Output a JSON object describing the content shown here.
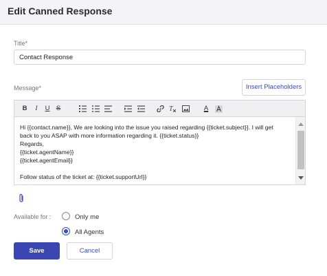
{
  "header": {
    "title": "Edit Canned Response"
  },
  "form": {
    "title_label": "Title*",
    "title_value": "Contact Response",
    "message_label": "Message*",
    "insert_placeholders_label": "Insert Placeholders",
    "toolbar": {
      "bold": "B",
      "italic": "I",
      "underline": "U",
      "strikethrough": "S",
      "font_color": "A",
      "icons": [
        "bold-icon",
        "italic-icon",
        "underline-icon",
        "strikethrough-icon",
        "ordered-list-icon",
        "bullet-list-icon",
        "align-icon",
        "indent-icon",
        "outdent-icon",
        "link-icon",
        "clear-format-icon",
        "image-icon",
        "font-color-icon",
        "background-color-icon"
      ]
    },
    "message_lines": [
      "Hi {{contact.name}}, We are looking into the issue you raised regarding {{ticket.subject}}. I will get",
      "back to you ASAP with more information regarding it. {{ticket.status}}",
      "Regards,",
      "{{ticket.agentName}}",
      "{{ticket.agentEmail}}",
      "",
      "Follow status of the ticket at: {{ticket.supportUrl}}"
    ],
    "available_for_label": "Available for :",
    "options": [
      {
        "label": "Only me",
        "selected": false
      },
      {
        "label": "All Agents",
        "selected": true
      }
    ],
    "save_label": "Save",
    "cancel_label": "Cancel"
  },
  "colors": {
    "accent": "#3b4bc8",
    "save_button": "#3b46b0",
    "header_bg": "#f4f4f8"
  }
}
